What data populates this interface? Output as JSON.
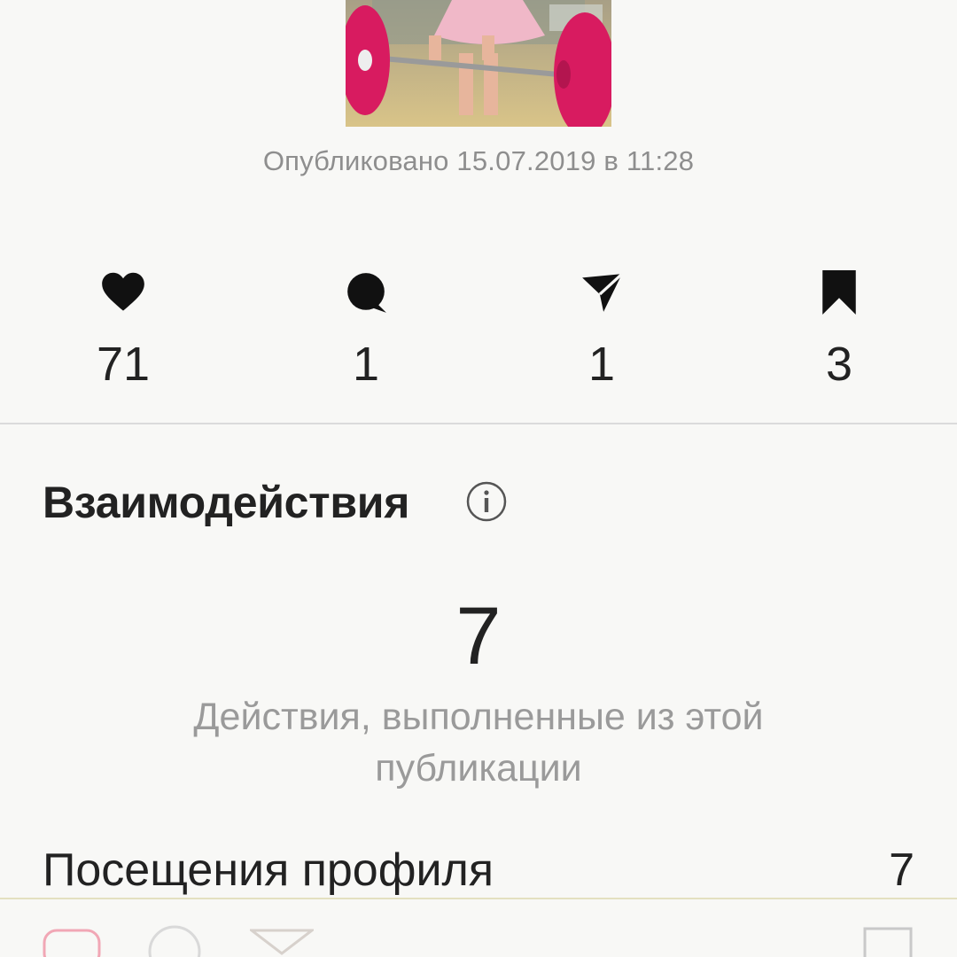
{
  "post": {
    "published_label": "Опубликовано 15.07.2019 в 11:28"
  },
  "stats": [
    {
      "icon": "heart-icon",
      "value": "71"
    },
    {
      "icon": "comment-icon",
      "value": "1"
    },
    {
      "icon": "send-icon",
      "value": "1"
    },
    {
      "icon": "bookmark-icon",
      "value": "3"
    }
  ],
  "interactions": {
    "title": "Взаимодействия",
    "total": "7",
    "caption": "Действия, выполненные из этой публикации",
    "rows": [
      {
        "label": "Посещения профиля",
        "value": "7"
      }
    ]
  },
  "colors": {
    "background": "#f8f8f6",
    "text": "#222222",
    "secondary_text": "#8e8e8e",
    "divider": "#dbdbdb",
    "weight_plate": "#d81b60"
  }
}
